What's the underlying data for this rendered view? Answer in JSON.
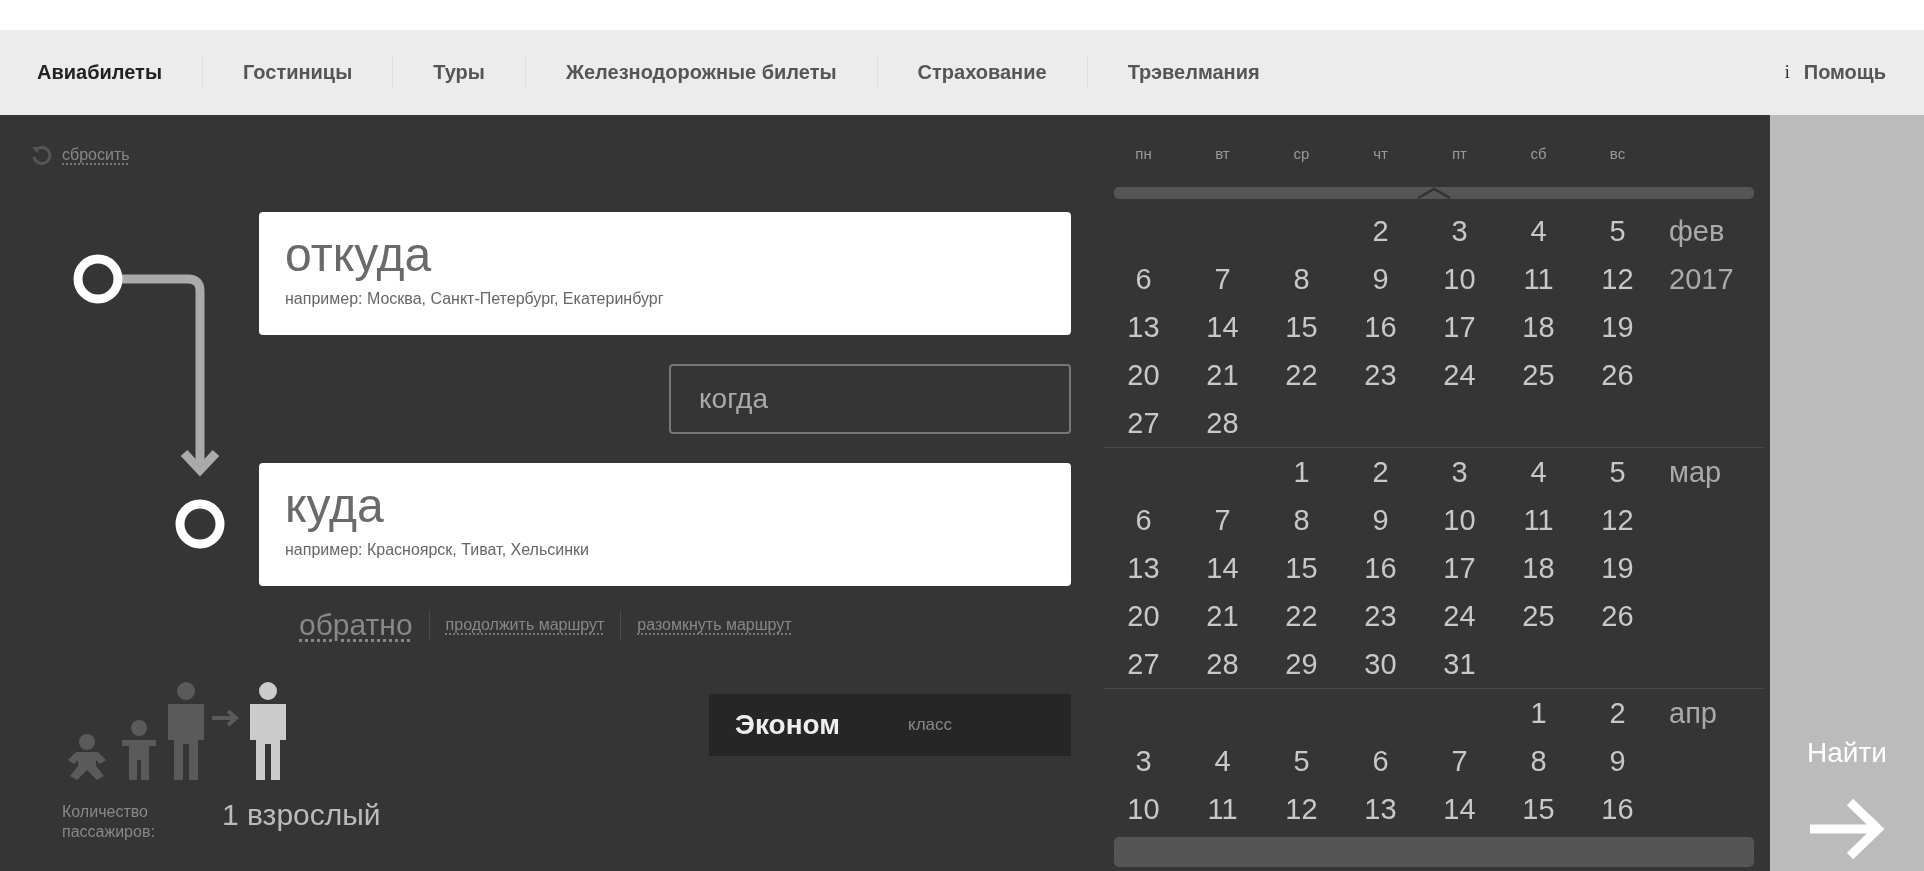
{
  "nav": {
    "items": [
      {
        "label": "Авиабилеты",
        "selected": true
      },
      {
        "label": "Гостиницы",
        "selected": false
      },
      {
        "label": "Туры",
        "selected": false
      },
      {
        "label": "Железнодорожные билеты",
        "selected": false
      },
      {
        "label": "Страхование",
        "selected": false
      },
      {
        "label": "Трэвелмания",
        "selected": false
      }
    ],
    "help": {
      "icon": "i",
      "label": "Помощь"
    }
  },
  "form": {
    "reset": "сбросить",
    "from": {
      "placeholder": "откуда",
      "hint": "например: Москва, Санкт-Петербург, Екатеринбург"
    },
    "when": {
      "placeholder": "когда"
    },
    "to": {
      "placeholder": "куда",
      "hint": "например: Красноярск, Тиват, Хельсинки"
    },
    "links": [
      {
        "label": "обратно",
        "kind": "main"
      },
      {
        "label": "продолжить маршрут",
        "kind": "minor"
      },
      {
        "label": "разомкнуть маршрут",
        "kind": "minor"
      }
    ],
    "passengers": {
      "label": "Количество пассажиров:",
      "value": "1 взрослый"
    },
    "class": {
      "value": "Эконом",
      "label": "класс"
    }
  },
  "calendar": {
    "weekdays": [
      "пн",
      "вт",
      "ср",
      "чт",
      "пт",
      "сб",
      "вс"
    ],
    "months": [
      {
        "name": "фев",
        "year": "2017",
        "weeks": [
          {
            "kind": "leading",
            "days": [
              "2",
              "3",
              "4",
              "5"
            ]
          },
          {
            "kind": "full",
            "days": [
              "6",
              "7",
              "8",
              "9",
              "10",
              "11",
              "12"
            ]
          },
          {
            "kind": "full",
            "days": [
              "13",
              "14",
              "15",
              "16",
              "17",
              "18",
              "19"
            ]
          },
          {
            "kind": "full",
            "days": [
              "20",
              "21",
              "22",
              "23",
              "24",
              "25",
              "26"
            ]
          },
          {
            "kind": "trailing",
            "days": [
              "27",
              "28"
            ]
          }
        ]
      },
      {
        "name": "мар",
        "weeks": [
          {
            "kind": "leading",
            "days": [
              "1",
              "2",
              "3",
              "4",
              "5"
            ]
          },
          {
            "kind": "full",
            "days": [
              "6",
              "7",
              "8",
              "9",
              "10",
              "11",
              "12"
            ]
          },
          {
            "kind": "full",
            "days": [
              "13",
              "14",
              "15",
              "16",
              "17",
              "18",
              "19"
            ]
          },
          {
            "kind": "full",
            "days": [
              "20",
              "21",
              "22",
              "23",
              "24",
              "25",
              "26"
            ]
          },
          {
            "kind": "trailing",
            "days": [
              "27",
              "28",
              "29",
              "30",
              "31"
            ]
          }
        ]
      },
      {
        "name": "апр",
        "weeks": [
          {
            "kind": "leading",
            "days": [
              "1",
              "2"
            ]
          },
          {
            "kind": "full",
            "days": [
              "3",
              "4",
              "5",
              "6",
              "7",
              "8",
              "9"
            ]
          },
          {
            "kind": "full",
            "days": [
              "10",
              "11",
              "12",
              "13",
              "14",
              "15",
              "16"
            ]
          }
        ]
      }
    ]
  },
  "search_button": {
    "label": "Найти"
  }
}
